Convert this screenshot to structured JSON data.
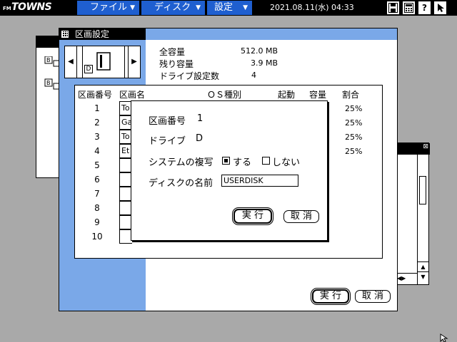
{
  "menubar": {
    "logo_prefix": "FM",
    "logo": "TOWNS",
    "menus": [
      {
        "label": "ファイル"
      },
      {
        "label": "ディスク"
      },
      {
        "label": "設定"
      }
    ],
    "clock": "2021.08.11(水) 04:33",
    "icons": [
      "floppy-icon",
      "calculator-icon",
      "help-icon",
      "pointer-icon"
    ]
  },
  "window": {
    "title": "区画設定",
    "info": {
      "total_label": "全容量",
      "total_value": "512.0 MB",
      "free_label": "残り容量",
      "free_value": "3.9 MB",
      "count_label": "ドライブ設定数",
      "count_value": "4"
    },
    "drive_letter": "D",
    "table": {
      "headers": [
        "区画番号",
        "区画名",
        "ＯＳ種別",
        "起動",
        "容量",
        "割合"
      ],
      "rows": [
        {
          "num": "1",
          "name": "To",
          "pct": "25%"
        },
        {
          "num": "2",
          "name": "Ga",
          "pct": "25%"
        },
        {
          "num": "3",
          "name": "To",
          "pct": "25%"
        },
        {
          "num": "4",
          "name": "Et",
          "pct": "25%"
        },
        {
          "num": "5",
          "name": "",
          "pct": ""
        },
        {
          "num": "6",
          "name": "",
          "pct": ""
        },
        {
          "num": "7",
          "name": "",
          "pct": ""
        },
        {
          "num": "8",
          "name": "",
          "pct": ""
        },
        {
          "num": "9",
          "name": "",
          "pct": ""
        },
        {
          "num": "10",
          "name": "",
          "pct": ""
        }
      ]
    },
    "execute_label": "実 行",
    "cancel_label": "取 消"
  },
  "dialog": {
    "partition_label": "区画番号",
    "partition_value": "1",
    "drive_label": "ドライブ",
    "drive_value": "D",
    "copy_label": "システムの複写",
    "copy_yes": "する",
    "copy_no": "しない",
    "copy_selected": "する",
    "name_label": "ディスクの名前",
    "name_value": "USERDISK",
    "execute_label": "実 行",
    "cancel_label": "取 消"
  }
}
